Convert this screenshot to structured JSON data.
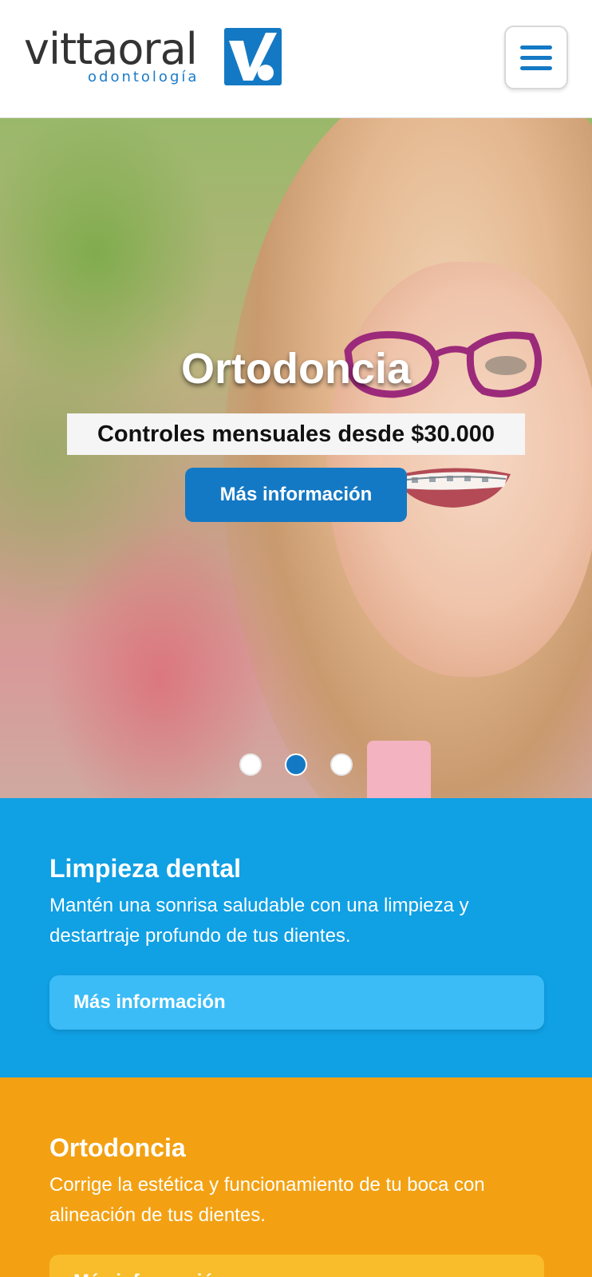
{
  "header": {
    "logo_word": "vittaoral",
    "logo_sub": "odontología",
    "brand_color": "#1479c4",
    "menu_icon": "hamburger-menu-icon"
  },
  "hero": {
    "title": "Ortodoncia",
    "subtitle": "Controles mensuales desde $30.000",
    "button_label": "Más información",
    "slides_count": 3,
    "active_slide": 2
  },
  "cards": [
    {
      "title": "Limpieza dental",
      "text": "Mantén una sonrisa saludable con una limpieza y destartraje profundo de tus dientes.",
      "button_label": "Más información",
      "color": "#10a0e4"
    },
    {
      "title": "Ortodoncia",
      "text": "Corrige la estética y funcionamiento de tu boca con alineación de tus dientes.",
      "button_label": "Más información",
      "color": "#f3a112"
    }
  ]
}
